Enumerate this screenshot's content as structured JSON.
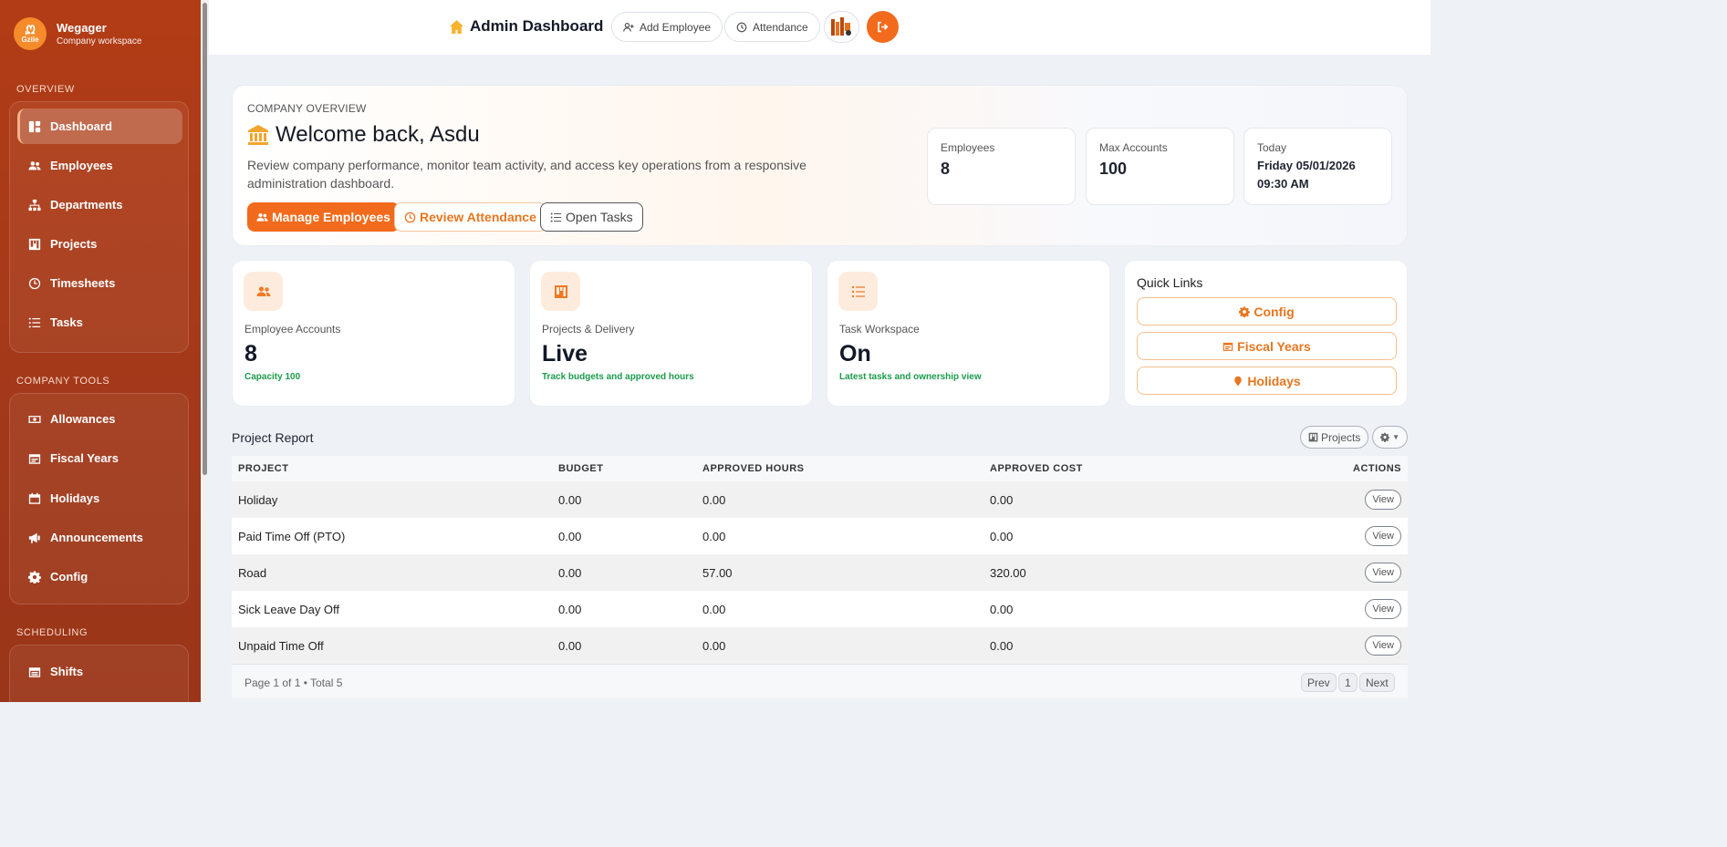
{
  "brand": {
    "logo_text": "Gzile",
    "name": "Wegager",
    "subtitle": "Company workspace"
  },
  "sidebar": {
    "sections": [
      {
        "label": "OVERVIEW",
        "items": [
          {
            "label": "Dashboard",
            "icon": "dashboard-icon",
            "active": true
          },
          {
            "label": "Employees",
            "icon": "users-icon"
          },
          {
            "label": "Departments",
            "icon": "sitemap-icon"
          },
          {
            "label": "Projects",
            "icon": "kanban-icon"
          },
          {
            "label": "Timesheets",
            "icon": "clock-icon"
          },
          {
            "label": "Tasks",
            "icon": "list-icon"
          }
        ]
      },
      {
        "label": "COMPANY TOOLS",
        "items": [
          {
            "label": "Allowances",
            "icon": "money-icon"
          },
          {
            "label": "Fiscal Years",
            "icon": "calendar-range-icon"
          },
          {
            "label": "Holidays",
            "icon": "calendar-icon"
          },
          {
            "label": "Announcements",
            "icon": "megaphone-icon"
          },
          {
            "label": "Config",
            "icon": "gear-icon"
          }
        ]
      },
      {
        "label": "SCHEDULING",
        "items": [
          {
            "label": "Shifts",
            "icon": "calendar-icon"
          }
        ]
      }
    ]
  },
  "topbar": {
    "title": "Admin Dashboard",
    "add_employee": "Add Employee",
    "attendance": "Attendance"
  },
  "hero": {
    "overline": "COMPANY OVERVIEW",
    "title": "Welcome back, Asdu",
    "description": "Review company performance, monitor team activity, and access key operations from a responsive administration dashboard.",
    "buttons": {
      "manage": "Manage Employees",
      "review": "Review Attendance",
      "tasks": "Open Tasks"
    },
    "stats": [
      {
        "label": "Employees",
        "value": "8"
      },
      {
        "label": "Max Accounts",
        "value": "100"
      },
      {
        "label": "Today",
        "value": "Friday 05/01/2026 09:30 AM"
      }
    ]
  },
  "cards": [
    {
      "label": "Employee Accounts",
      "value": "8",
      "sub": "Capacity 100",
      "icon": "users-icon"
    },
    {
      "label": "Projects & Delivery",
      "value": "Live",
      "sub": "Track budgets and approved hours",
      "icon": "kanban-icon"
    },
    {
      "label": "Task Workspace",
      "value": "On",
      "sub": "Latest tasks and ownership view",
      "icon": "list-icon"
    }
  ],
  "quick_links": {
    "title": "Quick Links",
    "items": [
      {
        "label": "Config",
        "icon": "gear-icon"
      },
      {
        "label": "Fiscal Years",
        "icon": "calendar-range-icon"
      },
      {
        "label": "Holidays",
        "icon": "map-pin-icon"
      }
    ]
  },
  "report": {
    "title": "Project Report",
    "projects_button": "Projects",
    "columns": [
      "PROJECT",
      "BUDGET",
      "APPROVED HOURS",
      "APPROVED COST",
      "ACTIONS"
    ],
    "rows": [
      {
        "project": "Holiday",
        "budget": "0.00",
        "hours": "0.00",
        "cost": "0.00",
        "action": "View"
      },
      {
        "project": "Paid Time Off (PTO)",
        "budget": "0.00",
        "hours": "0.00",
        "cost": "0.00",
        "action": "View"
      },
      {
        "project": "Road",
        "budget": "0.00",
        "hours": "57.00",
        "cost": "320.00",
        "action": "View"
      },
      {
        "project": "Sick Leave Day Off",
        "budget": "0.00",
        "hours": "0.00",
        "cost": "0.00",
        "action": "View"
      },
      {
        "project": "Unpaid Time Off",
        "budget": "0.00",
        "hours": "0.00",
        "cost": "0.00",
        "action": "View"
      }
    ],
    "footer": {
      "info": "Page 1 of 1 • Total 5",
      "prev": "Prev",
      "page": "1",
      "next": "Next"
    }
  },
  "colors": {
    "accent": "#f26a1b",
    "sidebar": "#a3391a",
    "success": "#1b9c4b"
  }
}
